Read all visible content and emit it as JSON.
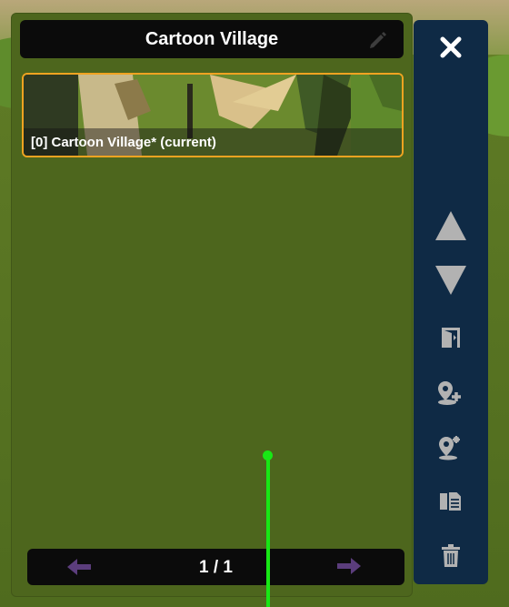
{
  "title": "Cartoon Village",
  "scenes": [
    {
      "label": "[0] Cartoon Village* (current)"
    }
  ],
  "pagination": {
    "text": "1 / 1"
  },
  "colors": {
    "panel_bg": "#4d661d",
    "title_bg": "#0b0b0b",
    "toolbar_bg": "#0f2a45",
    "selection_border": "#f0a321",
    "pointer": "#18e815",
    "arrow_icon": "#5b3d7c"
  },
  "toolbar": {
    "icons": [
      "close-icon",
      "move-up-icon",
      "move-down-icon",
      "door-exit-icon",
      "add-location-icon",
      "location-settings-icon",
      "duplicate-icon",
      "trash-icon"
    ]
  }
}
